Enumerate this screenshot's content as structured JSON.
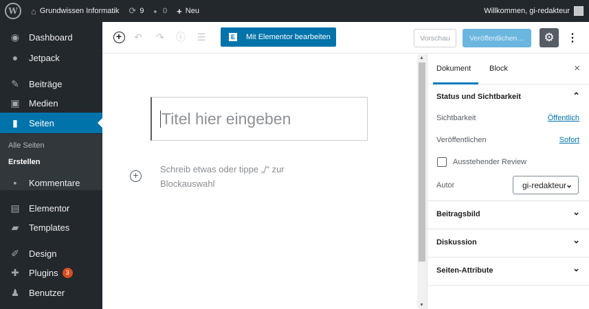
{
  "adminbar": {
    "wp_logo": "W",
    "site_name": "Grundwissen Informatik",
    "updates_count": "9",
    "comments_count": "0",
    "new_label": "Neu",
    "welcome": "Willkommen, gi-redakteur"
  },
  "sidebar": {
    "items": [
      {
        "label": "Dashboard",
        "icon": "dashboard-icon"
      },
      {
        "label": "Jetpack",
        "icon": "jetpack-icon"
      },
      {
        "label": "Beiträge",
        "icon": "pin-icon"
      },
      {
        "label": "Medien",
        "icon": "media-icon"
      },
      {
        "label": "Seiten",
        "icon": "pages-icon"
      },
      {
        "label": "Kommentare",
        "icon": "comment-icon"
      },
      {
        "label": "Elementor",
        "icon": "elementor-icon"
      },
      {
        "label": "Templates",
        "icon": "folder-icon"
      },
      {
        "label": "Design",
        "icon": "brush-icon"
      },
      {
        "label": "Plugins",
        "icon": "plugin-icon",
        "badge": "3"
      },
      {
        "label": "Benutzer",
        "icon": "user-icon"
      }
    ],
    "submenu": [
      "Alle Seiten",
      "Erstellen"
    ]
  },
  "toolbar": {
    "elementor_label": "Mit Elementor bearbeiten",
    "elementor_icon": "E",
    "preview_label": "Vorschau",
    "publish_label": "Veröffentlichen…"
  },
  "editor": {
    "title_placeholder": "Titel hier eingeben",
    "block_placeholder": "Schreib etwas oder tippe „/“ zur Blockauswahl"
  },
  "panel": {
    "tab_document": "Dokument",
    "tab_block": "Block",
    "close": "×",
    "status_title": "Status und Sichtbarkeit",
    "visibility_label": "Sichtbarkeit",
    "visibility_value": "Öffentlich",
    "publish_label": "Veröffentlichen",
    "publish_value": "Sofort",
    "pending_review": "Ausstehender Review",
    "author_label": "Autor",
    "author_value": "gi-redakteur",
    "featured_image": "Beitragsbild",
    "discussion": "Diskussion",
    "page_attributes": "Seiten-Attribute"
  },
  "colors": {
    "adminbar": "#23282d",
    "accent": "#0073aa",
    "publish_disabled": "#6bb6de",
    "badge": "#d54e21"
  }
}
